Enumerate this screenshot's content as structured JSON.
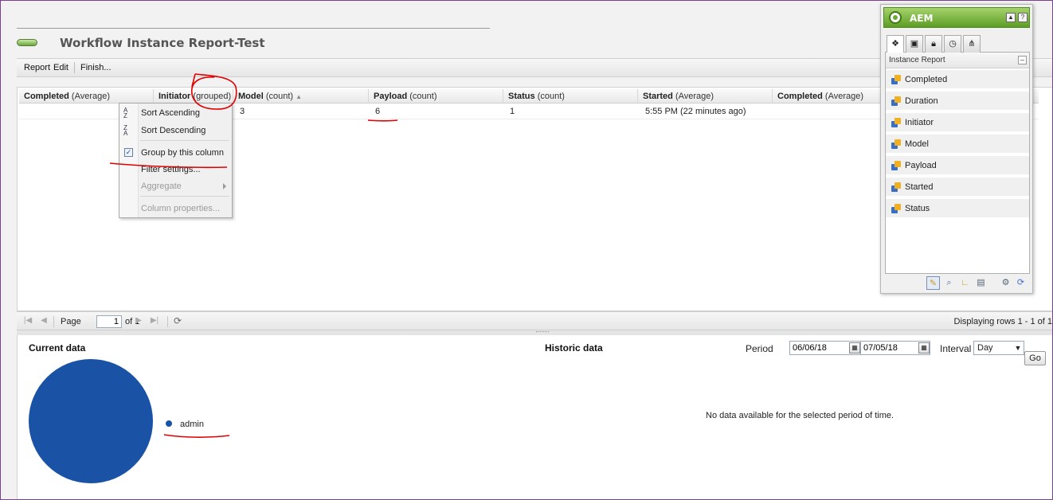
{
  "page": {
    "title": "Workflow Instance Report-Test"
  },
  "toolbar": {
    "report": "Report",
    "edit": "Edit",
    "finish": "Finish..."
  },
  "grid": {
    "columns": [
      {
        "name": "Completed",
        "agg": "(Average)"
      },
      {
        "name": "Initiator",
        "agg": "(grouped)"
      },
      {
        "name": "Model",
        "agg": "(count)"
      },
      {
        "name": "Payload",
        "agg": "(count)"
      },
      {
        "name": "Status",
        "agg": "(count)"
      },
      {
        "name": "Started",
        "agg": "(Average)"
      },
      {
        "name": "Completed",
        "agg": "(Average)"
      }
    ],
    "rows": [
      {
        "model": "3",
        "payload": "6",
        "status": "1",
        "started": "5:55 PM (22 minutes ago)"
      }
    ]
  },
  "context_menu": {
    "sort_asc": "Sort Ascending",
    "sort_desc": "Sort Descending",
    "group": "Group by this column",
    "filter": "Filter settings...",
    "aggregate": "Aggregate",
    "column_props": "Column properties..."
  },
  "pager": {
    "page_label": "Page",
    "page_value": "1",
    "of_label": "of 1",
    "display": "Displaying rows 1 - 1 of 1"
  },
  "bottom": {
    "current_title": "Current data",
    "historic_title": "Historic data",
    "period_label": "Period",
    "period_from": "06/06/18",
    "period_to": "07/05/18",
    "interval_label": "Interval",
    "interval_value": "Day",
    "go": "Go",
    "no_data": "No data available for the selected period of time."
  },
  "chart_data": {
    "type": "pie",
    "categories": [
      "admin"
    ],
    "values": [
      1
    ],
    "colors": [
      "#1a52a6"
    ],
    "legend": "right"
  },
  "sidekick": {
    "title": "AEM",
    "panel_title": "Instance Report",
    "items": [
      "Completed",
      "Duration",
      "Initiator",
      "Model",
      "Payload",
      "Started",
      "Status"
    ]
  },
  "colors": {
    "pie": "#1a52a6",
    "sidekick_header": "#6aa83b",
    "annotation": "#e00000"
  }
}
